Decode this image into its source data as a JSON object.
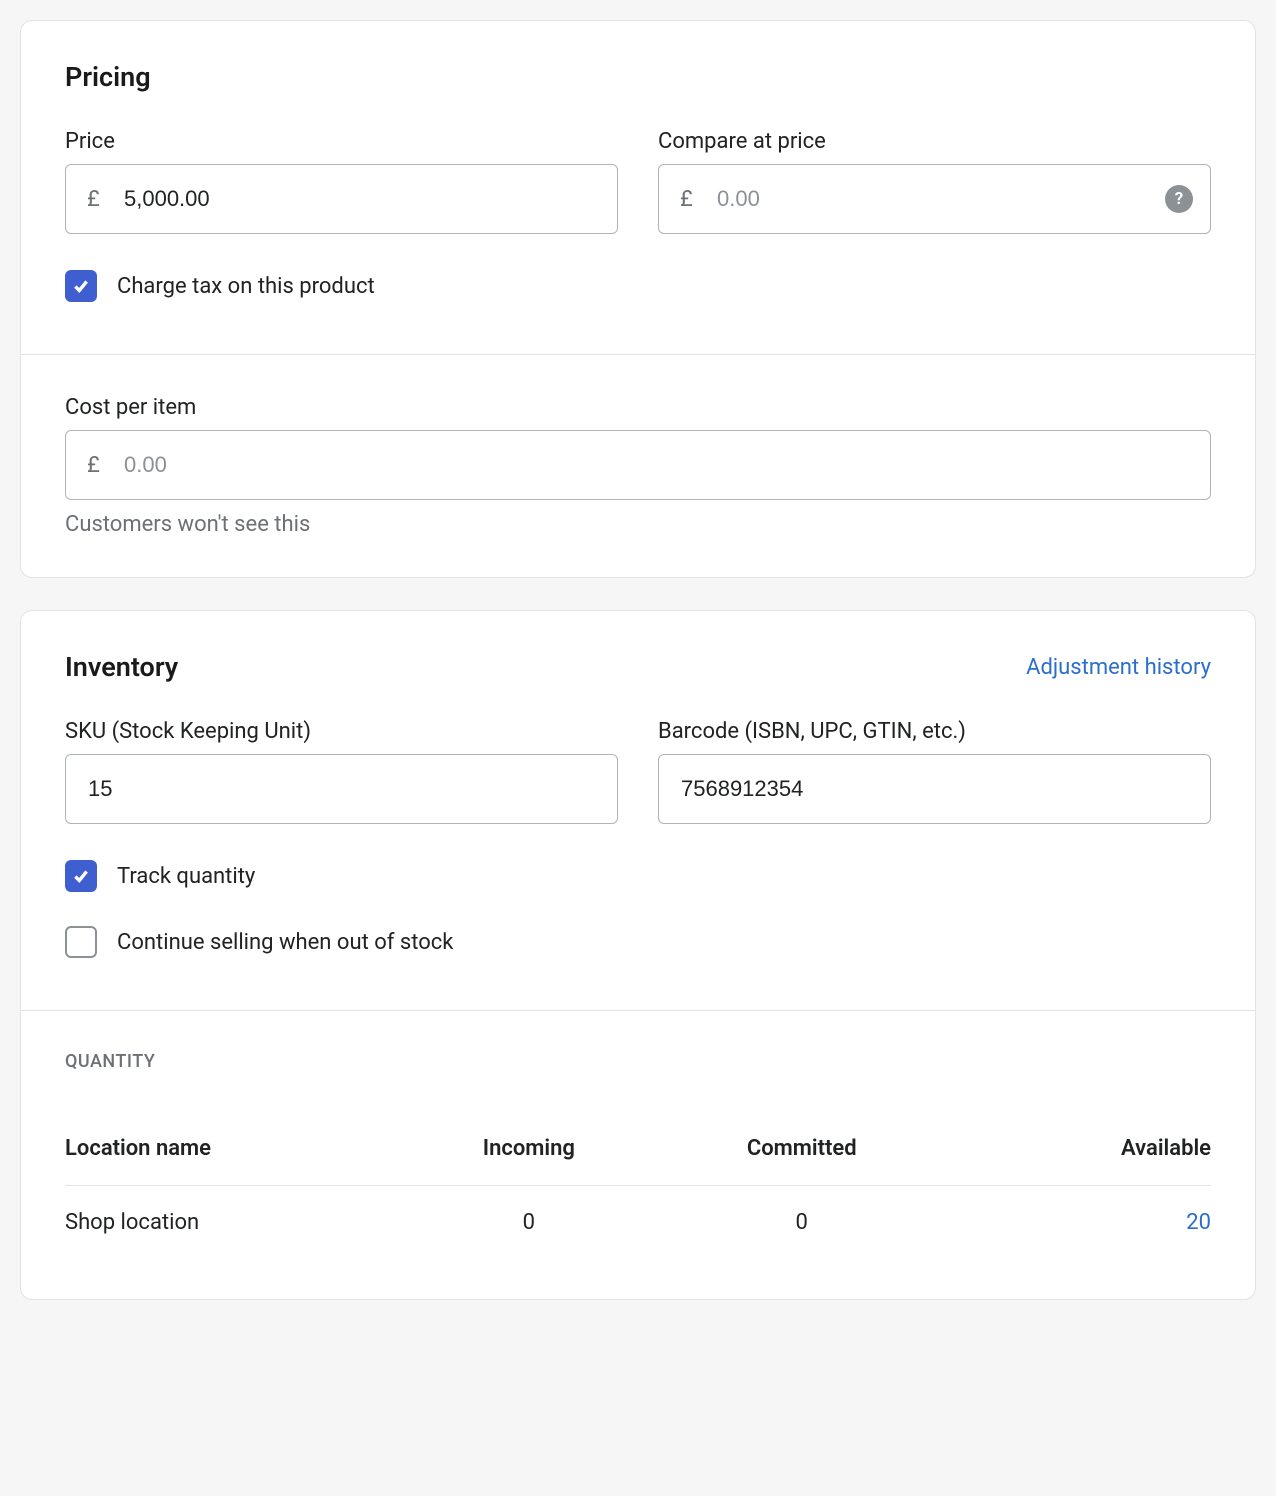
{
  "pricing": {
    "title": "Pricing",
    "price_label": "Price",
    "price_currency": "£",
    "price_value": "5,000.00",
    "compare_label": "Compare at price",
    "compare_currency": "£",
    "compare_placeholder": "0.00",
    "charge_tax_label": "Charge tax on this product",
    "charge_tax_checked": true,
    "cost_label": "Cost per item",
    "cost_currency": "£",
    "cost_placeholder": "0.00",
    "cost_helper": "Customers won't see this"
  },
  "inventory": {
    "title": "Inventory",
    "history_link": "Adjustment history",
    "sku_label": "SKU (Stock Keeping Unit)",
    "sku_value": "15",
    "barcode_label": "Barcode (ISBN, UPC, GTIN, etc.)",
    "barcode_value": "7568912354",
    "track_label": "Track quantity",
    "track_checked": true,
    "continue_label": "Continue selling when out of stock",
    "continue_checked": false,
    "quantity_heading": "QUANTITY",
    "table": {
      "headers": {
        "location": "Location name",
        "incoming": "Incoming",
        "committed": "Committed",
        "available": "Available"
      },
      "row": {
        "location": "Shop location",
        "incoming": "0",
        "committed": "0",
        "available": "20"
      }
    }
  }
}
